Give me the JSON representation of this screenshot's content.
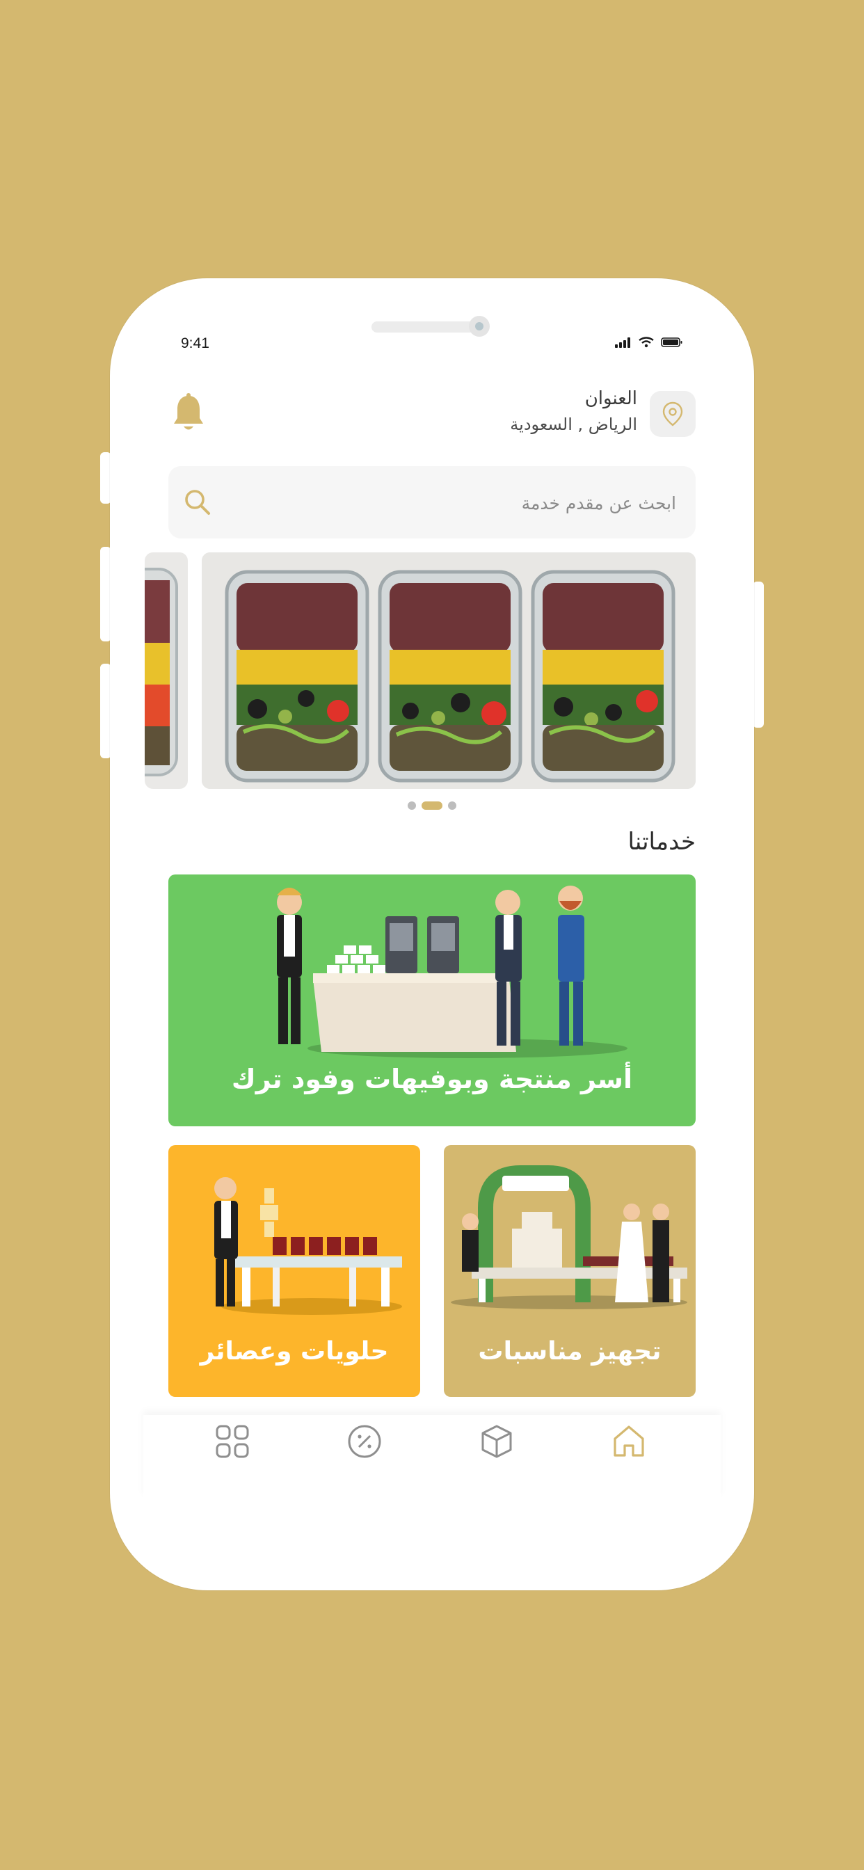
{
  "status_bar": {
    "time": "9:41"
  },
  "header": {
    "address_label": "العنوان",
    "address_value": "الرياض , السعودية"
  },
  "search": {
    "placeholder": "ابحث عن مقدم خدمة"
  },
  "carousel": {
    "pages": 3,
    "active_index": 1
  },
  "services": {
    "title": "خدماتنا",
    "cards": [
      {
        "label": "أسر منتجة وبوفيهات وفود ترك",
        "color": "#6CC961"
      },
      {
        "label": "تجهيز مناسبات",
        "color": "#D4B86F"
      },
      {
        "label": "حلويات وعصائر",
        "color": "#FDB52B"
      }
    ]
  },
  "tab_bar": {
    "items": [
      {
        "icon": "grid-icon"
      },
      {
        "icon": "discount-icon"
      },
      {
        "icon": "box-icon"
      },
      {
        "icon": "home-icon",
        "active": true
      }
    ]
  },
  "colors": {
    "background": "#D4B86F",
    "accent": "#D4B86F",
    "green": "#6CC961",
    "yellow": "#FDB52B"
  }
}
